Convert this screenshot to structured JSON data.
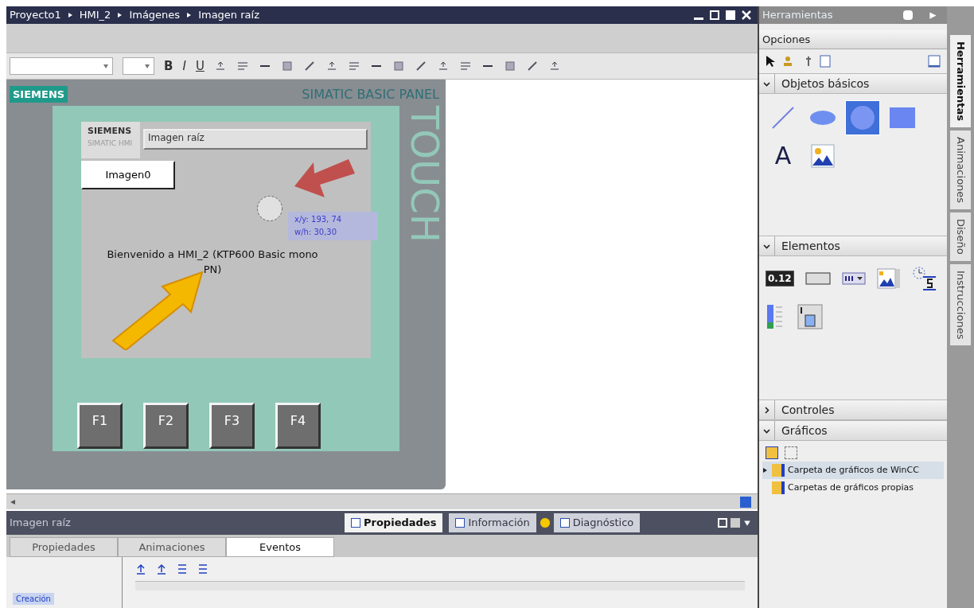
{
  "breadcrumb": [
    "Proyecto1",
    "HMI_2",
    "Imágenes",
    "Imagen raíz"
  ],
  "toolbar": {
    "format_buttons": [
      "B",
      "I",
      "U"
    ]
  },
  "device": {
    "brand": "SIEMENS",
    "model": "SIMATIC BASIC PANEL",
    "side_label": "TOUCH",
    "screen": {
      "logo": "SIEMENS",
      "logo_sub": "SIMATIC HMI",
      "title_field": "Imagen raíz",
      "button": "Imagen0",
      "tooltip": [
        "x/y: 193, 74",
        "w/h: 30,30"
      ],
      "welcome": "Bienvenido a HMI_2 (KTP600 Basic mono PN)"
    },
    "function_keys": [
      "F1",
      "F2",
      "F3",
      "F4"
    ]
  },
  "inspector": {
    "title": "Imagen raíz",
    "views": [
      {
        "label": "Propiedades",
        "selected": true
      },
      {
        "label": "Información",
        "selected": false
      },
      {
        "label": "Diagnóstico",
        "selected": false
      }
    ],
    "tabs": [
      {
        "label": "Propiedades",
        "selected": false
      },
      {
        "label": "Animaciones",
        "selected": false
      },
      {
        "label": "Eventos",
        "selected": true
      }
    ],
    "event_item": "Creación"
  },
  "tools": {
    "title": "Herramientas",
    "options_label": "Opciones",
    "basic_objects": {
      "label": "Objetos básicos",
      "expanded": true,
      "items": [
        {
          "kind": "line",
          "selected": false
        },
        {
          "kind": "ellipse",
          "selected": false
        },
        {
          "kind": "circle",
          "selected": true
        },
        {
          "kind": "rectangle",
          "selected": false
        },
        {
          "kind": "text",
          "label": "A",
          "selected": false
        },
        {
          "kind": "graphic",
          "selected": false
        }
      ]
    },
    "elements": {
      "label": "Elementos",
      "expanded": true,
      "items": [
        {
          "kind": "io",
          "label": "0.12"
        },
        {
          "kind": "button"
        },
        {
          "kind": "symbolic"
        },
        {
          "kind": "graphic_io"
        },
        {
          "kind": "clock"
        },
        {
          "kind": "bar"
        },
        {
          "kind": "switch"
        }
      ]
    },
    "controls": {
      "label": "Controles",
      "expanded": false
    },
    "graphics": {
      "label": "Gráficos",
      "expanded": true,
      "folders": [
        {
          "label": "Carpeta de gráficos de WinCC",
          "selected": true,
          "has_children": true
        },
        {
          "label": "Carpetas de gráficos propias",
          "selected": false,
          "has_children": false
        }
      ]
    }
  },
  "side_tabs": [
    {
      "label": "Herramientas",
      "selected": true
    },
    {
      "label": "Animaciones",
      "selected": false
    },
    {
      "label": "Diseño",
      "selected": false
    },
    {
      "label": "Instrucciones",
      "selected": false
    }
  ]
}
